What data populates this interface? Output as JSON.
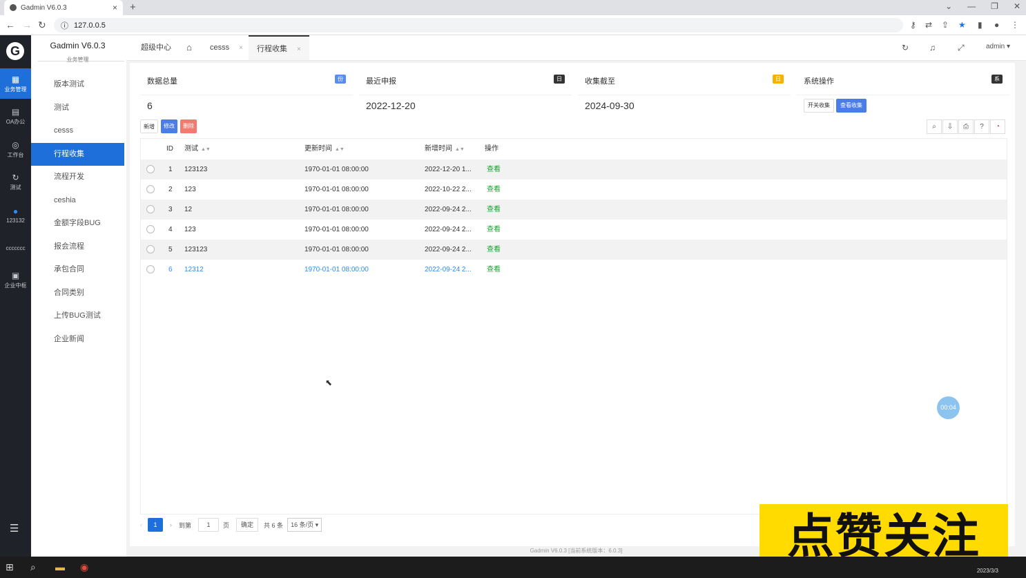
{
  "browser": {
    "tab_title": "Gadmin V6.0.3",
    "url": "127.0.0.5",
    "window_controls": [
      "⌄",
      "—",
      "❐",
      "✕"
    ]
  },
  "iconbar": {
    "items": [
      {
        "label": "业务管理",
        "glyph": "▦"
      },
      {
        "label": "OA办公",
        "glyph": "▤"
      },
      {
        "label": "工作台",
        "glyph": "◎"
      },
      {
        "label": "测试",
        "glyph": "↻"
      },
      {
        "label": "123132",
        "glyph": "●"
      },
      {
        "label": "ccccccc",
        "glyph": ""
      },
      {
        "label": "企业中枢",
        "glyph": "▣"
      }
    ]
  },
  "sidebar": {
    "title": "Gadmin V6.0.3",
    "subtitle": "业务管理",
    "items": [
      "版本测试",
      "测试",
      "cesss",
      "行程收集",
      "流程开发",
      "ceshia",
      "金额字段BUG",
      "报会流程",
      "承包合同",
      "合同类别",
      "上传BUG测试",
      "企业新闻"
    ]
  },
  "topbar": {
    "tabs": [
      "超级中心",
      "cesss",
      "行程收集"
    ],
    "user": "admin"
  },
  "cards": [
    {
      "title": "数据总量",
      "badge": "份",
      "badge_color": "#5b8def",
      "value": "6"
    },
    {
      "title": "最近申报",
      "badge": "日",
      "badge_color": "#333333",
      "value": "2022-12-20"
    },
    {
      "title": "收集截至",
      "badge": "日",
      "badge_color": "#f5b300",
      "value": "2024-09-30"
    },
    {
      "title": "系统操作",
      "badge": "系",
      "badge_color": "#333333",
      "buttons": [
        "开关收集",
        "查看收集"
      ]
    }
  ],
  "toolbar": {
    "add": "新增",
    "edit": "修改",
    "delete": "删除"
  },
  "table": {
    "headers": [
      "ID",
      "测试",
      "更新时间",
      "新增时间",
      "操作"
    ],
    "rows": [
      {
        "id": "1",
        "test": "123123",
        "updated": "1970-01-01 08:00:00",
        "created": "2022-12-20 1...",
        "action": "查看"
      },
      {
        "id": "2",
        "test": "123",
        "updated": "1970-01-01 08:00:00",
        "created": "2022-10-22 2...",
        "action": "查看"
      },
      {
        "id": "3",
        "test": "12",
        "updated": "1970-01-01 08:00:00",
        "created": "2022-09-24 2...",
        "action": "查看"
      },
      {
        "id": "4",
        "test": "123",
        "updated": "1970-01-01 08:00:00",
        "created": "2022-09-24 2...",
        "action": "查看"
      },
      {
        "id": "5",
        "test": "123123",
        "updated": "1970-01-01 08:00:00",
        "created": "2022-09-24 2...",
        "action": "查看"
      },
      {
        "id": "6",
        "test": "12312",
        "updated": "1970-01-01 08:00:00",
        "created": "2022-09-24 2...",
        "action": "查看"
      }
    ]
  },
  "pager": {
    "current": "1",
    "goto_label": "到第",
    "goto_value": "1",
    "page_unit": "页",
    "confirm": "确定",
    "total": "共 6 条",
    "page_size": "16 条/页"
  },
  "footer": "Gadmin V6.0.3 [当前系统版本：6.0.3]",
  "timer": "00:04",
  "banner": "点赞关注",
  "taskbar": {
    "date": "2023/3/3"
  }
}
